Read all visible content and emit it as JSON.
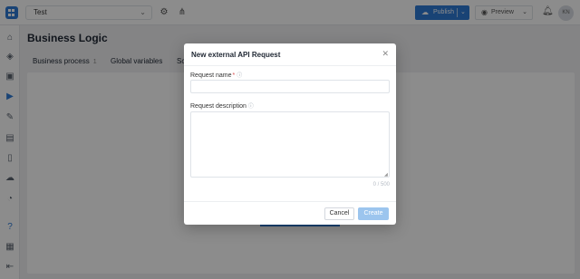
{
  "header": {
    "project_name": "Test",
    "publish_label": "Publish",
    "preview_label": "Preview",
    "avatar_initials": "KN"
  },
  "page": {
    "title": "Business Logic",
    "tabs": [
      {
        "label": "Business process",
        "count": "1"
      },
      {
        "label": "Global variables",
        "count": ""
      },
      {
        "label": "Sc",
        "count": ""
      }
    ]
  },
  "modal": {
    "title": "New external API Request",
    "name_label": "Request name",
    "required_mark": "*",
    "description_label": "Request description",
    "counter": "0 / 500",
    "cancel_label": "Cancel",
    "create_label": "Create"
  },
  "colors": {
    "accent": "#2f7ad6",
    "create_disabled": "#9cc5ee"
  }
}
